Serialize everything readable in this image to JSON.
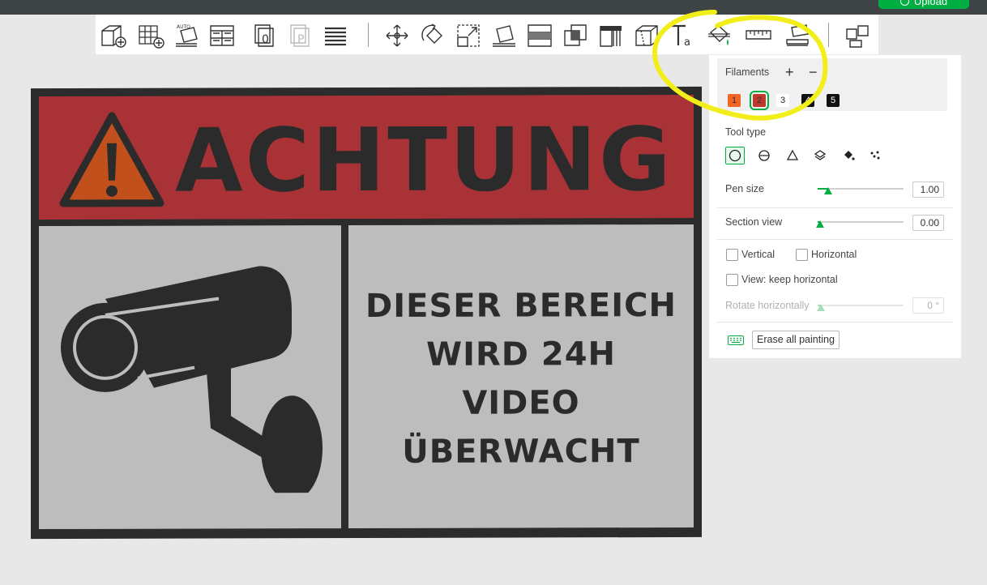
{
  "window": {
    "upload_label": "Upload"
  },
  "toolbar": {
    "icons": [
      "add-cube-icon",
      "add-plate-icon",
      "auto-orient-icon",
      "arrange-icon",
      "plate-0-icon",
      "plate-p-icon",
      "layers-icon",
      "move-icon",
      "rotate-icon",
      "scale-icon",
      "lay-on-face-icon",
      "cut-icon",
      "boolean-icon",
      "support-paint-icon",
      "seam-paint-icon",
      "text-icon",
      "color-paint-icon",
      "measure-icon",
      "assembly-icon",
      "split-parts-icon"
    ],
    "auto_label": "AUTO"
  },
  "scene": {
    "banner_text": "ACHTUNG",
    "body_lines": [
      "DIESER BEREICH",
      "WIRD 24H",
      "VIDEO",
      "ÜBERWACHT"
    ],
    "colors": {
      "banner": "#a83236",
      "triangle": "#c1501c",
      "panel": "#bdbdbd",
      "dark": "#2b2b2b"
    }
  },
  "paint_panel": {
    "filaments": {
      "title": "Filaments",
      "add": "+",
      "remove": "−",
      "items": [
        {
          "label": "1",
          "color": "#f26522",
          "text_color": "#333333"
        },
        {
          "label": "2",
          "color": "#c0392b",
          "text_color": "#333333",
          "selected": true
        },
        {
          "label": "3",
          "color": "#ffffff",
          "text_color": "#222222"
        },
        {
          "label": "4",
          "color": "#111111",
          "text_color": "#ffffff"
        },
        {
          "label": "5",
          "color": "#111111",
          "text_color": "#ffffff"
        }
      ]
    },
    "tool_type": {
      "title": "Tool type",
      "tools": [
        "circle-brush-icon",
        "sphere-brush-icon",
        "triangle-brush-icon",
        "height-range-icon",
        "fill-bucket-icon",
        "gap-fill-icon"
      ]
    },
    "pen_size": {
      "label": "Pen size",
      "value": "1.00",
      "fraction": 0.12
    },
    "section_view": {
      "label": "Section view",
      "value": "0.00",
      "fraction": 0.03
    },
    "vertical_label": "Vertical",
    "horizontal_label": "Horizontal",
    "keep_horizontal_label": "View: keep horizontal",
    "rotate_horizontally": {
      "label": "Rotate horizontally",
      "value": "0 °",
      "fraction": 0.04
    },
    "erase_all_label": "Erase all painting"
  },
  "accent": "#00ae42",
  "annotation_color": "#f2ee1a"
}
